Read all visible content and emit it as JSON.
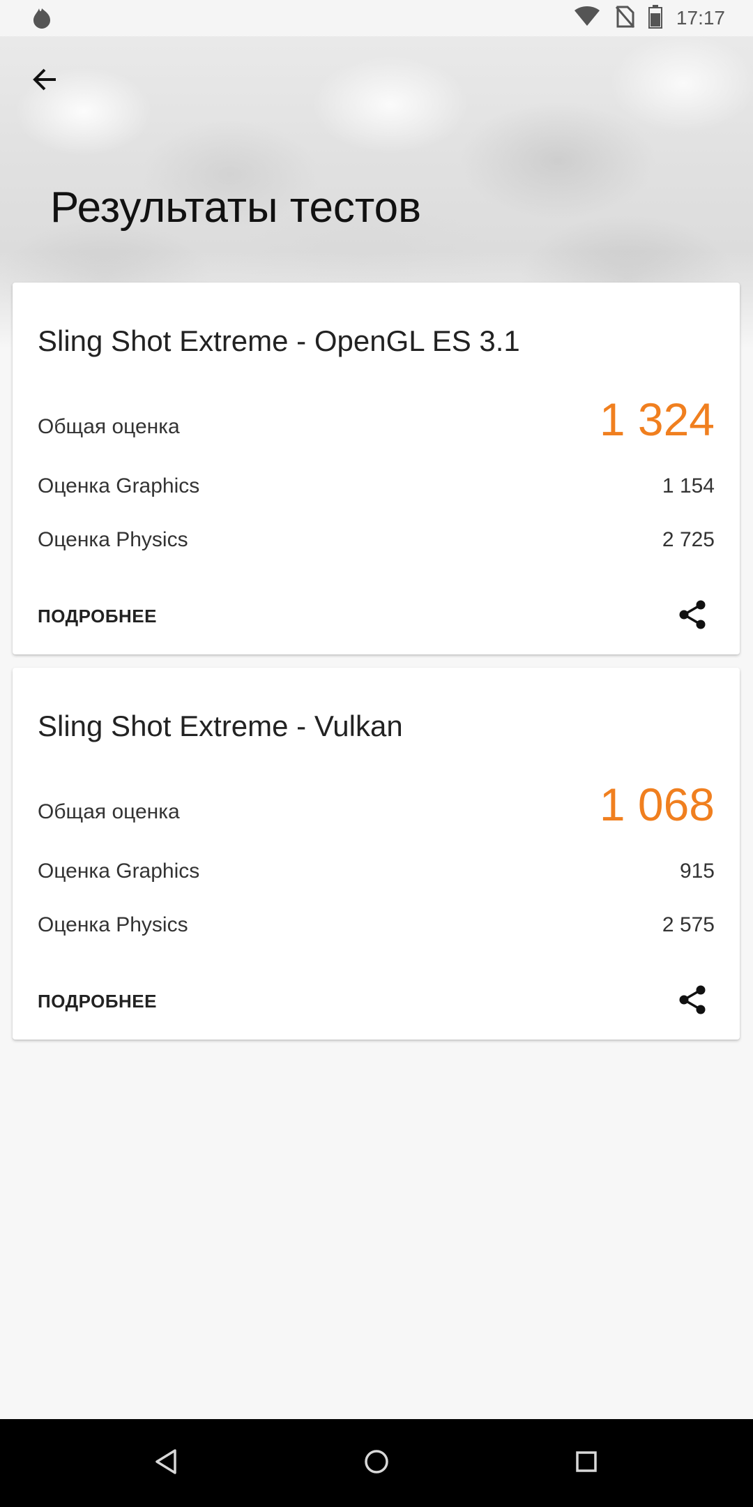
{
  "status_bar": {
    "time": "17:17",
    "icons": [
      "app-notification-icon",
      "wifi-icon",
      "no-sim-icon",
      "battery-icon"
    ]
  },
  "header": {
    "back_icon": "arrow-back-icon",
    "title": "Результаты тестов"
  },
  "colors": {
    "score_accent": "#f07f1f",
    "nav_bar": "#000000",
    "background": "#f7f7f7"
  },
  "results": [
    {
      "title": "Sling Shot Extreme - OpenGL ES 3.1",
      "overall_label": "Общая оценка",
      "overall_value": "1 324",
      "graphics_label": "Оценка Graphics",
      "graphics_value": "1 154",
      "physics_label": "Оценка Physics",
      "physics_value": "2 725",
      "details_label": "ПОДРОБНЕЕ",
      "share_icon": "share-icon"
    },
    {
      "title": "Sling Shot Extreme - Vulkan",
      "overall_label": "Общая оценка",
      "overall_value": "1 068",
      "graphics_label": "Оценка Graphics",
      "graphics_value": "915",
      "physics_label": "Оценка Physics",
      "physics_value": "2 575",
      "details_label": "ПОДРОБНЕЕ",
      "share_icon": "share-icon"
    }
  ],
  "nav_bar": {
    "icons": [
      "nav-back-icon",
      "nav-home-icon",
      "nav-recents-icon"
    ]
  }
}
